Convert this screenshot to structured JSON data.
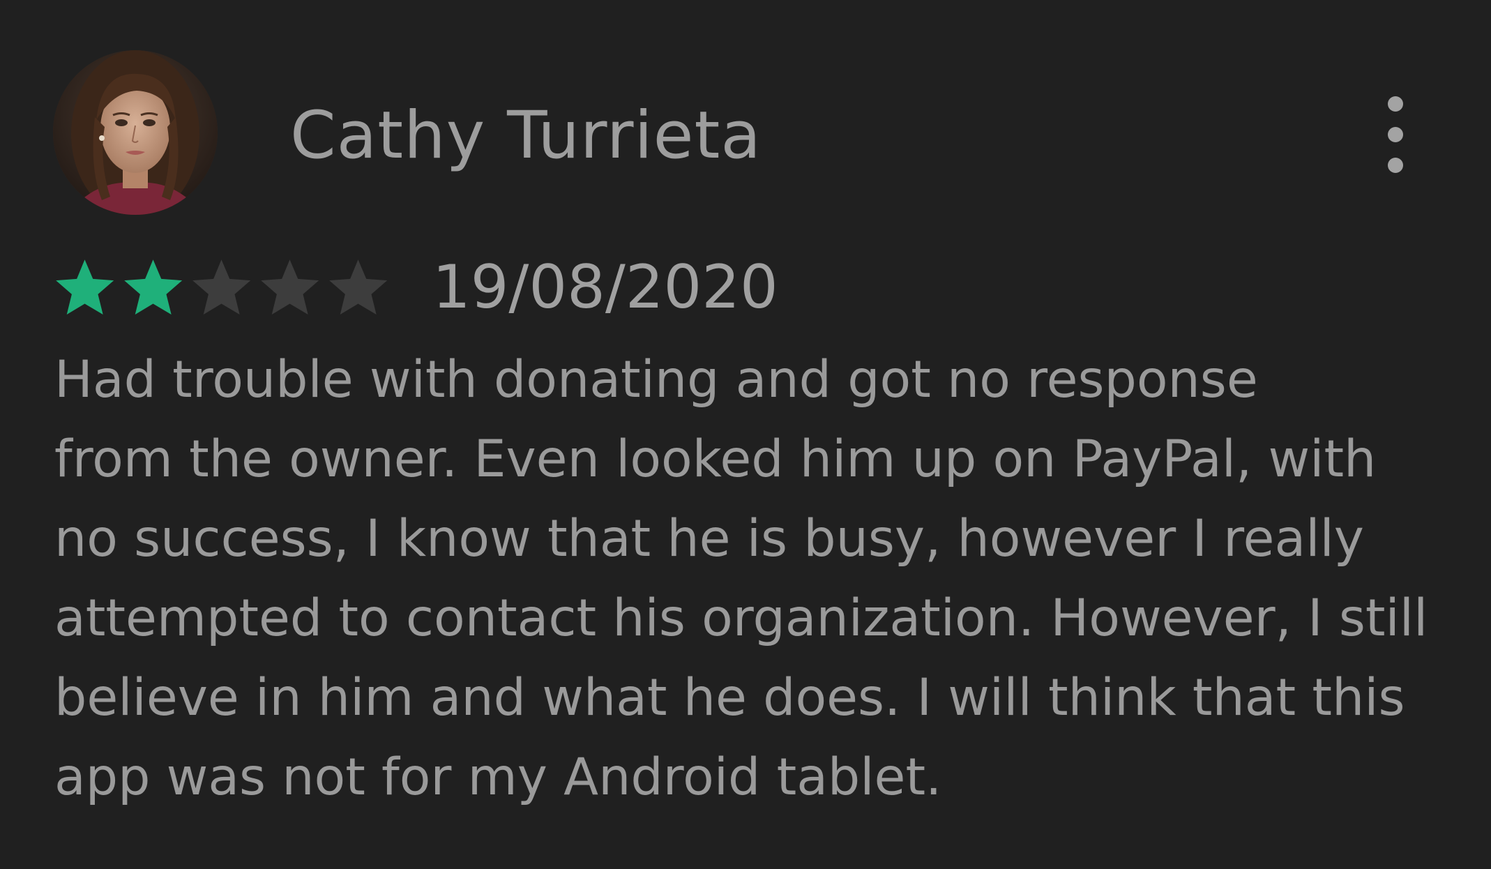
{
  "review": {
    "author": "Cathy Turrieta",
    "avatar_icon": "user-avatar-photo",
    "more_icon": "more-vertical-icon",
    "rating": 2,
    "max_rating": 5,
    "star_filled_color": "#1fb07a",
    "star_empty_color": "#3d3d3d",
    "date": "19/08/2020",
    "body_lines": [
      "Had trouble with donating and got no response",
      "from the owner. Even looked him up on PayPal, with",
      "no success, I know that he is busy, however I really",
      "attempted to contact his organization. However, I still",
      "believe in him and what he does. I will think that this",
      "app was not for my Android tablet."
    ]
  }
}
